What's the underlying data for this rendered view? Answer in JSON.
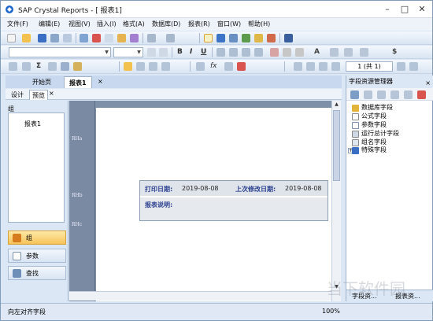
{
  "window": {
    "title": "SAP Crystal Reports - [ 报表1]"
  },
  "menu": [
    "文件(F)",
    "编辑(E)",
    "视图(V)",
    "插入(I)",
    "格式(A)",
    "数据库(D)",
    "报表(R)",
    "窗口(W)",
    "帮助(H)"
  ],
  "toolbar": {
    "page_indicator": "1 (共 1)"
  },
  "doc_tabs": [
    "开始页",
    "报表1"
  ],
  "view_tabs": [
    "设计",
    "预览"
  ],
  "left_panel": {
    "group_header": "组",
    "tree_item": "报表1",
    "nav_buttons": [
      "组",
      "参数",
      "查找"
    ]
  },
  "sections": [
    "RHa",
    "RHb",
    "RHc"
  ],
  "report": {
    "print_date_label": "打印日期:",
    "print_date_value": "2019-08-08",
    "modified_label": "上次修改日期:",
    "modified_value": "2019-08-08",
    "comments_label": "报表说明:"
  },
  "field_explorer": {
    "title": "字段资源管理器",
    "items": [
      "数据库字段",
      "公式字段",
      "参数字段",
      "运行总计字段",
      "组名字段",
      "特殊字段"
    ],
    "tabs": [
      "字段资...",
      "报表资..."
    ]
  },
  "status": {
    "text": "向左对齐字段",
    "zoom": "100%"
  },
  "watermark": "当下软件园",
  "colors": {
    "accent": "#f7c35a",
    "label_blue": "#2a3f8f",
    "workspace": "#7e8fa8"
  }
}
